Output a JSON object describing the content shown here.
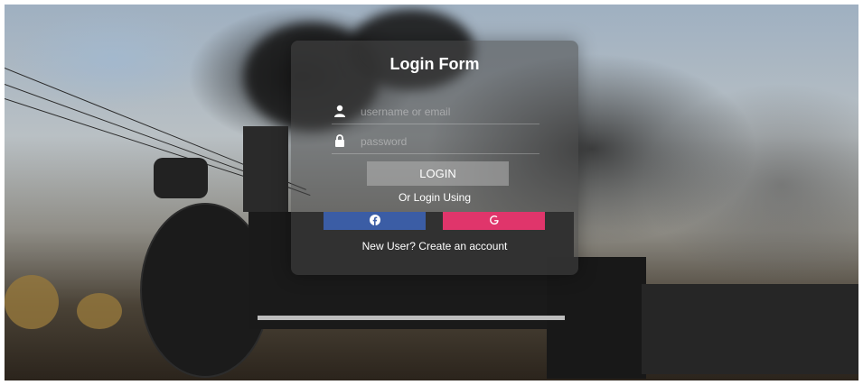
{
  "form": {
    "title": "Login Form",
    "username_placeholder": "username or email",
    "password_placeholder": "password",
    "login_label": "LOGIN",
    "or_text": "Or Login Using",
    "new_user_text": "New User? Create an account"
  },
  "social": {
    "facebook_icon": "facebook-icon",
    "google_icon": "google-icon",
    "facebook_color": "#3b5da5",
    "google_color": "#e0356b"
  },
  "background": {
    "description_icon": "locomotive-photo"
  }
}
